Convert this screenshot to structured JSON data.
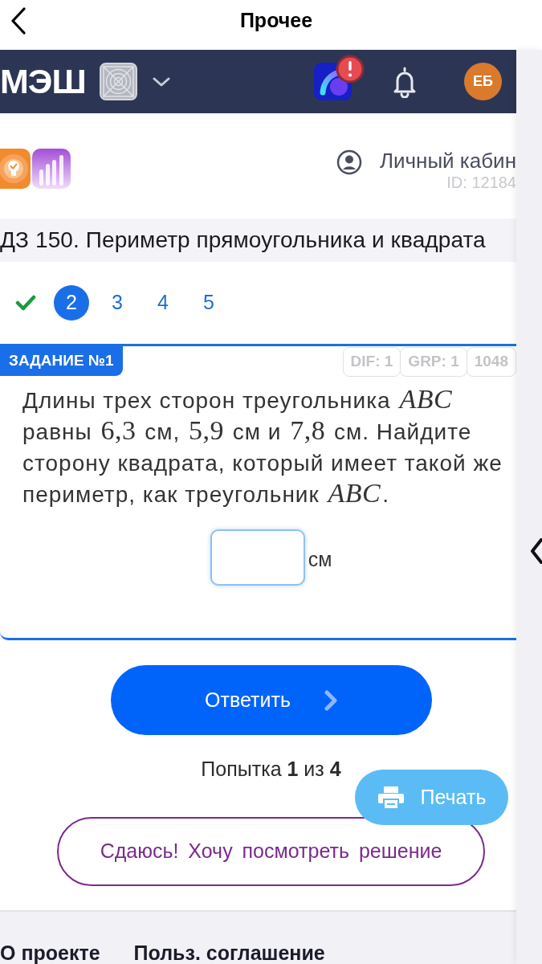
{
  "top_bar": {
    "title": "Прочее"
  },
  "navbar": {
    "logo": "МЭШ",
    "app_alert": true,
    "avatar": "ЕБ"
  },
  "account": {
    "label": "Личный кабин",
    "id": "ID: 12184"
  },
  "task_title": "ДЗ 150. Периметр прямоугольника и квадрата",
  "pagination": [
    {
      "kind": "done",
      "selected": false
    },
    {
      "kind": "number",
      "label": "2",
      "selected": true
    },
    {
      "kind": "number",
      "label": "3",
      "selected": false
    },
    {
      "kind": "number",
      "label": "4",
      "selected": false
    },
    {
      "kind": "number",
      "label": "5",
      "selected": false
    }
  ],
  "task": {
    "label": "ЗАДАНИЕ №1",
    "tags": [
      "DIF: 1",
      "GRP: 1",
      "1048"
    ],
    "question": [
      {
        "kind": "text",
        "text": "Длины трех сторон треугольника "
      },
      {
        "kind": "math_var",
        "text": "ABC"
      },
      {
        "kind": "text",
        "text": " равны "
      },
      {
        "kind": "math_num",
        "text": "6,3"
      },
      {
        "kind": "text",
        "text": " см, "
      },
      {
        "kind": "math_num",
        "text": "5,9"
      },
      {
        "kind": "text",
        "text": " см и "
      },
      {
        "kind": "math_num",
        "text": "7,8"
      },
      {
        "kind": "text",
        "text": " см. Найдите сторону квадрата, который имеет такой же периметр, как треугольник "
      },
      {
        "kind": "math_var",
        "text": "ABC"
      },
      {
        "kind": "text",
        "text": "."
      }
    ],
    "answer_unit": "см"
  },
  "submit_button": "Ответить",
  "attempts": "Попытка **1** из **4**",
  "print_button": "Печать",
  "give_up_button": "Сдаюсь! Хочу посмотреть решение",
  "footer_links": [
    "О проекте",
    "Польз. соглашение"
  ]
}
